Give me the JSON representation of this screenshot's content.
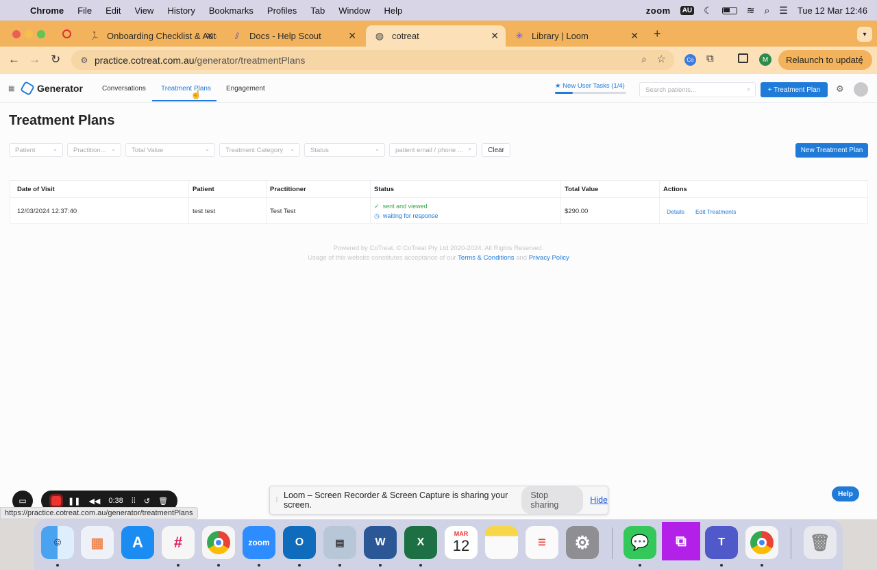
{
  "menubar": {
    "app_name": "Chrome",
    "items": [
      "File",
      "Edit",
      "View",
      "History",
      "Bookmarks",
      "Profiles",
      "Tab",
      "Window",
      "Help"
    ],
    "zoom_label": "zoom",
    "input_source": "AU",
    "datetime": "Tue 12 Mar  12:46"
  },
  "browser": {
    "tabs": [
      {
        "title": "Onboarding Checklist & Autom",
        "icon": "runner-icon"
      },
      {
        "title": "Docs - Help Scout",
        "icon": "helpscout-icon"
      },
      {
        "title": "cotreat",
        "icon": "globe-icon"
      },
      {
        "title": "Library | Loom",
        "icon": "loom-icon"
      }
    ],
    "url_host": "practice.cotreat.com.au",
    "url_path": "/generator/treatmentPlans",
    "profile_initial": "M",
    "relaunch_label": "Relaunch to update",
    "status_url": "https://practice.cotreat.com.au/generator/treatmentPlans"
  },
  "app": {
    "title": "Generator",
    "nav": [
      "Conversations",
      "Treatment Plans",
      "Engagement"
    ],
    "tasks_label": "New User Tasks (1/4)",
    "tasks_progress": 0.25,
    "search_placeholder": "Search patients...",
    "add_plan_label": "+ Treatment Plan"
  },
  "page": {
    "title": "Treatment Plans",
    "filters": {
      "patient": "Patient",
      "practitioner": "Practition...",
      "total_value": "Total Value",
      "category": "Treatment Category",
      "status": "Status",
      "search_placeholder": "patient email / phone ...",
      "clear_label": "Clear"
    },
    "new_plan_label": "New Treatment Plan",
    "table": {
      "headers": [
        "Date of Visit",
        "Patient",
        "Practitioner",
        "Status",
        "Total Value",
        "Actions"
      ],
      "rows": [
        {
          "date": "12/03/2024 12:37:40",
          "patient": "test test",
          "practitioner": "Test Test",
          "status_sent": "sent and viewed",
          "status_wait": "waiting for response",
          "total": "$290.00",
          "action_details": "Details",
          "action_edit": "Edit Treatments"
        }
      ]
    },
    "footer": {
      "line1": "Powered by CoTreat. © CoTreat Pty Ltd 2020-2024. All Rights Reserved.",
      "line2_prefix": "Usage of this website constitutes acceptance of our",
      "terms": "Terms & Conditions",
      "and": "and",
      "privacy": "Privacy Policy"
    },
    "help_label": "Help"
  },
  "loom": {
    "timer": "0:38",
    "share_message": "Loom – Screen Recorder & Screen Capture is sharing your screen.",
    "stop_label": "Stop sharing",
    "hide_label": "Hide"
  },
  "dock": {
    "calendar_month": "MAR",
    "calendar_day": "12",
    "zoom_label": "zoom"
  },
  "colors": {
    "accent": "#1f7ad8",
    "status_ok": "#3aa64a",
    "tabbar": "#f2b35c"
  }
}
